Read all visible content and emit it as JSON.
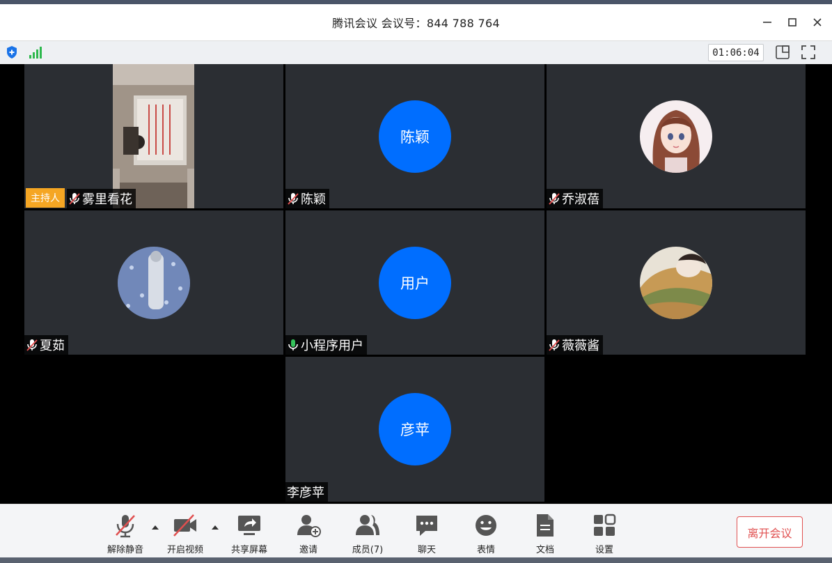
{
  "window": {
    "title": "腾讯会议 会议号：844 788 764",
    "timer": "01:06:04"
  },
  "colors": {
    "accent": "#006eff",
    "host_badge": "#f5a623",
    "leave": "#e04f4f",
    "muted_red": "#e04f4f",
    "mic_on_green": "#35c35b"
  },
  "participants": [
    {
      "name": "雾里看花",
      "host_label": "主持人",
      "avatar_type": "video",
      "mic": "muted"
    },
    {
      "name": "陈颖",
      "avatar_text": "陈颖",
      "avatar_type": "initials",
      "mic": "muted"
    },
    {
      "name": "乔淑蓓",
      "avatar_type": "photo",
      "mic": "muted"
    },
    {
      "name": "夏茹",
      "avatar_type": "photo",
      "mic": "muted"
    },
    {
      "name": "小程序用户",
      "avatar_text": "用户",
      "avatar_type": "initials",
      "mic": "on"
    },
    {
      "name": "薇薇酱",
      "avatar_type": "photo",
      "mic": "muted"
    },
    {
      "name": "李彦苹",
      "avatar_text": "彦苹",
      "avatar_type": "initials",
      "mic": "none"
    }
  ],
  "toolbar": {
    "unmute": "解除静音",
    "start_video": "开启视频",
    "share_screen": "共享屏幕",
    "invite": "邀请",
    "members": "成员(7)",
    "chat": "聊天",
    "reactions": "表情",
    "docs": "文档",
    "settings": "设置",
    "leave": "离开会议"
  }
}
